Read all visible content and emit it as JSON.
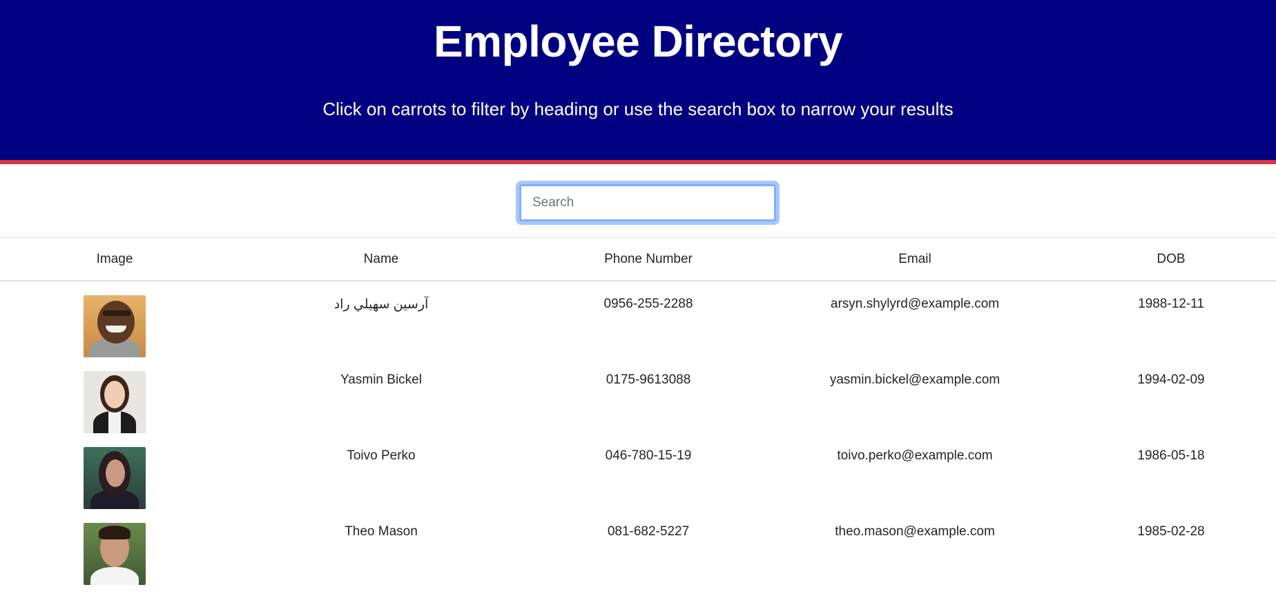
{
  "header": {
    "title": "Employee Directory",
    "subtitle": "Click on carrots to filter by heading or use the search box to narrow your results",
    "background_color": "#000080",
    "accent_border_color": "#dc3545"
  },
  "search": {
    "placeholder": "Search",
    "value": ""
  },
  "table": {
    "columns": [
      "Image",
      "Name",
      "Phone Number",
      "Email",
      "DOB"
    ],
    "rows": [
      {
        "image": "employee-photo",
        "name": "آرسین سهیلي راد",
        "phone": "0956-255-2288",
        "email": "arsyn.shylyrd@example.com",
        "dob": "1988-12-11"
      },
      {
        "image": "employee-photo",
        "name": "Yasmin Bickel",
        "phone": "0175-9613088",
        "email": "yasmin.bickel@example.com",
        "dob": "1994-02-09"
      },
      {
        "image": "employee-photo",
        "name": "Toivo Perko",
        "phone": "046-780-15-19",
        "email": "toivo.perko@example.com",
        "dob": "1986-05-18"
      },
      {
        "image": "employee-photo",
        "name": "Theo Mason",
        "phone": "081-682-5227",
        "email": "theo.mason@example.com",
        "dob": "1985-02-28"
      }
    ]
  }
}
